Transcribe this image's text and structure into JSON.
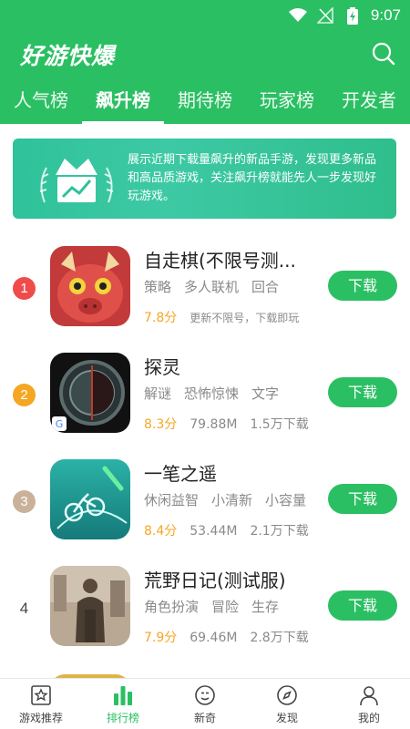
{
  "status_bar": {
    "time": "9:07"
  },
  "app_bar": {
    "title": "好游快爆"
  },
  "tabs": [
    {
      "label": "人气榜"
    },
    {
      "label": "飙升榜"
    },
    {
      "label": "期待榜"
    },
    {
      "label": "玩家榜"
    },
    {
      "label": "开发者"
    }
  ],
  "active_tab": "飙升榜",
  "banner": {
    "text": "展示近期下载量飙升的新品手游，发现更多新品和高品质游戏，关注飙升榜就能先人一步发现好玩游戏。"
  },
  "games": [
    {
      "rank": "1",
      "name": "自走棋(不限号测...",
      "tags": [
        "策略",
        "多人联机",
        "回合"
      ],
      "score": "7.8分",
      "meta": [
        "更新不限号，下载即玩"
      ],
      "button": "下载",
      "rank_color": "#f04b4b"
    },
    {
      "rank": "2",
      "name": "探灵",
      "tags": [
        "解谜",
        "恐怖惊悚",
        "文字"
      ],
      "score": "8.3分",
      "meta": [
        "79.88M",
        "1.5万下载"
      ],
      "button": "下载",
      "rank_color": "#f5a623"
    },
    {
      "rank": "3",
      "name": "一笔之遥",
      "tags": [
        "休闲益智",
        "小清新",
        "小容量"
      ],
      "score": "8.4分",
      "meta": [
        "53.44M",
        "2.1万下载"
      ],
      "button": "下载",
      "rank_color": "#c9b299"
    },
    {
      "rank": "4",
      "name": "荒野日记(测试服)",
      "tags": [
        "角色扮演",
        "冒险",
        "生存"
      ],
      "score": "7.9分",
      "meta": [
        "69.46M",
        "2.8万下载"
      ],
      "button": "下载",
      "rank_color": ""
    }
  ],
  "bottom_nav": [
    {
      "label": "游戏推荐",
      "icon": "star-card-icon"
    },
    {
      "label": "排行榜",
      "icon": "bar-chart-icon"
    },
    {
      "label": "新奇",
      "icon": "smile-icon"
    },
    {
      "label": "发现",
      "icon": "compass-icon"
    },
    {
      "label": "我的",
      "icon": "person-icon"
    }
  ],
  "colors": {
    "brand": "#2bbf63",
    "score": "#f5a623"
  }
}
